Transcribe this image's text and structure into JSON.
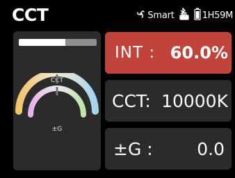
{
  "header": {
    "title": "CCT",
    "smart_label": "Smart",
    "battery_time": "1H59M",
    "icons": [
      "smart-fan-icon",
      "bluetooth-lock-icon",
      "battery-icon"
    ]
  },
  "intensity": {
    "label": "INT :",
    "value": "60.0%",
    "fraction": 0.6
  },
  "cct": {
    "label": "CCT:",
    "value": "10000K",
    "arc_label": "CCT"
  },
  "g": {
    "label": "±G :",
    "value": "0.0",
    "arc_label": "±G"
  },
  "colors": {
    "background": "#000000",
    "panel": "#2b2b2b",
    "int_card": "#c0443c",
    "cct_warm": "#f2c46c",
    "cct_cool": "#a8d2ee",
    "g_magenta": "#e7b2e9",
    "g_green": "#bfe3a8"
  }
}
